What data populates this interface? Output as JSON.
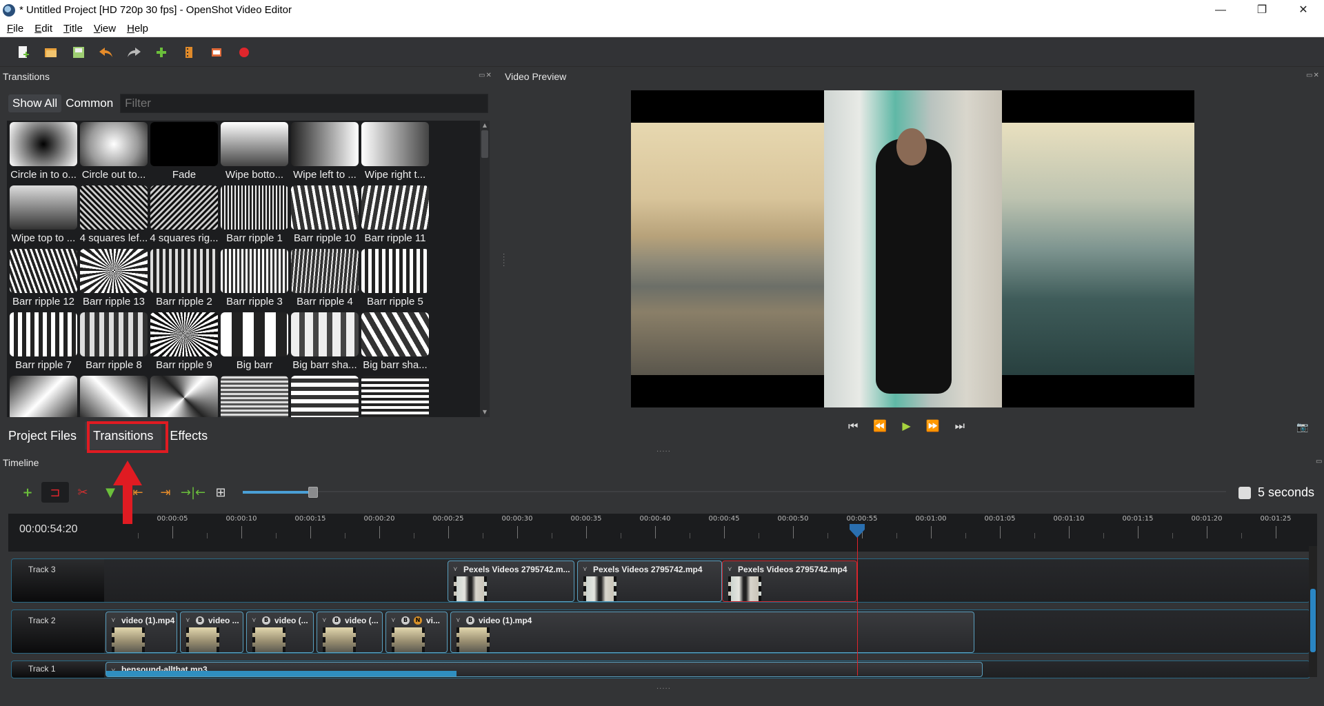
{
  "window": {
    "title": "* Untitled Project [HD 720p 30 fps] - OpenShot Video Editor",
    "controls": [
      "—",
      "❐",
      "✕"
    ]
  },
  "menu": [
    "File",
    "Edit",
    "Title",
    "View",
    "Help"
  ],
  "toolbar_icons": [
    "new-project-icon",
    "open-project-icon",
    "save-project-icon",
    "undo-icon",
    "redo-icon",
    "import-files-icon",
    "profile-icon",
    "fullscreen-icon",
    "export-video-icon"
  ],
  "transitions_panel": {
    "title": "Transitions",
    "filter_show_all": "Show All",
    "filter_common": "Common",
    "filter_placeholder": "Filter",
    "items": [
      "Circle in to o...",
      "Circle out to...",
      "Fade",
      "Wipe botto...",
      "Wipe left to ...",
      "Wipe right t...",
      "Wipe top to ...",
      "4 squares lef...",
      "4 squares rig...",
      "Barr ripple 1",
      "Barr ripple 10",
      "Barr ripple 11",
      "Barr ripple 12",
      "Barr ripple 13",
      "Barr ripple 2",
      "Barr ripple 3",
      "Barr ripple 4",
      "Barr ripple 5",
      "Barr ripple 7",
      "Barr ripple 8",
      "Barr ripple 9",
      "Big barr",
      "Big barr sha...",
      "Big barr sha...",
      "",
      "",
      "",
      "",
      "",
      ""
    ]
  },
  "bottom_tabs": [
    "Project Files",
    "Transitions",
    "Effects"
  ],
  "video_preview": {
    "title": "Video Preview"
  },
  "timeline": {
    "title": "Timeline",
    "zoom_label": "5 seconds",
    "current_time": "00:00:54:20",
    "ruler_labels": [
      "00:00:05",
      "00:00:10",
      "00:00:15",
      "00:00:20",
      "00:00:25",
      "00:00:30",
      "00:00:35",
      "00:00:40",
      "00:00:45",
      "00:00:50",
      "00:00:55",
      "00:01:00",
      "00:01:05",
      "00:01:10",
      "00:01:15",
      "00:01:20",
      "00:01:25"
    ],
    "tracks": [
      {
        "name": "Track 3",
        "clips": [
          {
            "label": "Pexels Videos 2795742.m...",
            "kind": "person"
          },
          {
            "label": "Pexels Videos 2795742.mp4",
            "kind": "person"
          },
          {
            "label": "Pexels Videos 2795742.mp4",
            "kind": "person",
            "selected": true
          }
        ]
      },
      {
        "name": "Track 2",
        "clips": [
          {
            "label": "video (1).mp4",
            "kind": "beach"
          },
          {
            "label": "video ...",
            "kind": "beach",
            "badge": "B"
          },
          {
            "label": "video (...",
            "kind": "beach",
            "badge": "B"
          },
          {
            "label": "video (...",
            "kind": "beach",
            "badge": "B"
          },
          {
            "label": "vi...",
            "kind": "beach",
            "badge": "B",
            "badge2": "N"
          },
          {
            "label": "video (1).mp4",
            "kind": "beach",
            "badge": "B"
          }
        ]
      },
      {
        "name": "Track 1",
        "clips": [
          {
            "label": "bensound-allthat.mp3",
            "kind": "audio"
          }
        ]
      }
    ]
  },
  "colors": {
    "accent": "#2a86c4",
    "highlight": "#e01b22",
    "play": "#a6d23e"
  }
}
